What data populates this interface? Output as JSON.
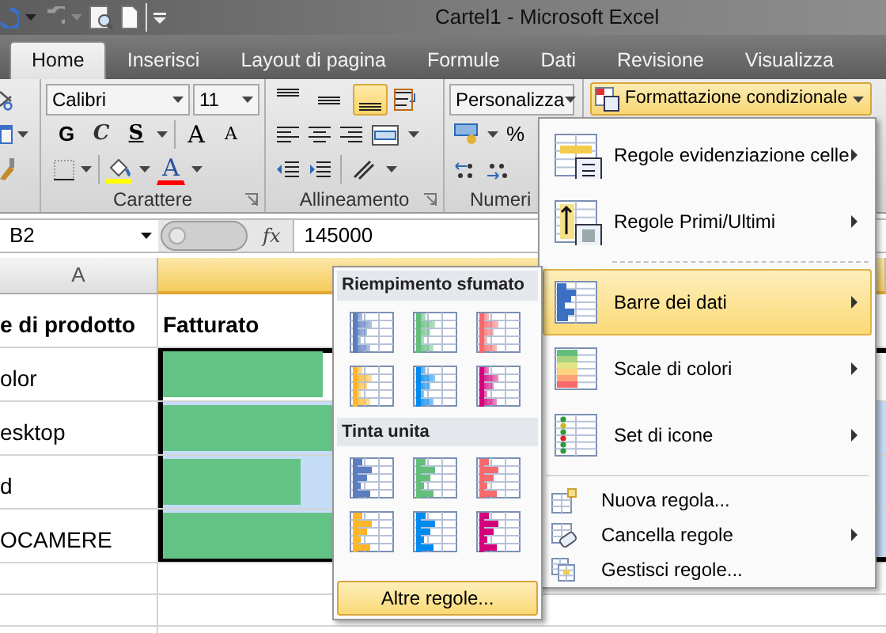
{
  "window": {
    "title": "Cartel1  -  Microsoft Excel"
  },
  "ribbon_tabs": [
    {
      "label": "Home",
      "selected": true
    },
    {
      "label": "Inserisci",
      "selected": false
    },
    {
      "label": "Layout di pagina",
      "selected": false
    },
    {
      "label": "Formule",
      "selected": false
    },
    {
      "label": "Dati",
      "selected": false
    },
    {
      "label": "Revisione",
      "selected": false
    },
    {
      "label": "Visualizza",
      "selected": false
    }
  ],
  "font_group": {
    "label": "Carattere",
    "font_name": "Calibri",
    "font_size": "11",
    "style_buttons": [
      {
        "label": "G",
        "kind": "bold"
      },
      {
        "label": "C",
        "kind": "italic"
      },
      {
        "label": "S",
        "kind": "underline"
      }
    ],
    "size_buttons": [
      {
        "label": "A",
        "kind": "grow"
      },
      {
        "label": "A",
        "kind": "shrink"
      }
    ],
    "fill_color_button": {
      "color": "#ffff00"
    },
    "font_color_button": {
      "label": "A",
      "color": "#ff0000"
    }
  },
  "alignment_group": {
    "label": "Allineamento",
    "vertical_align": [
      {
        "selected": false
      },
      {
        "selected": false
      },
      {
        "selected": true
      }
    ]
  },
  "number_group": {
    "label": "Numeri",
    "format": "Personalizza",
    "percent": "%"
  },
  "conditional_formatting": {
    "label": "Formattazione condizionale",
    "open": true
  },
  "formula_bar": {
    "name_box": "B2",
    "function_label": "fx",
    "value": "145000"
  },
  "sheet": {
    "column_headers": [
      {
        "label": "A",
        "selected": false
      },
      {
        "selected": true
      }
    ],
    "rows": [
      {
        "kind": "header",
        "cells": [
          "e di prodotto",
          "Fatturato"
        ]
      },
      {
        "kind": "data",
        "product": "olor",
        "bar": {
          "level": 0.22
        },
        "selected": true,
        "active": true
      },
      {
        "kind": "data",
        "product": "esktop",
        "bar": {
          "level": 0.5
        },
        "selected": true,
        "active": false
      },
      {
        "kind": "data",
        "product": "d",
        "bar": {
          "level": 0.19
        },
        "selected": true,
        "active": false
      },
      {
        "kind": "data",
        "product": "OCAMERE",
        "bar": {
          "level": 0.5
        },
        "selected": true,
        "active": false
      },
      {
        "kind": "empty"
      },
      {
        "kind": "empty"
      },
      {
        "kind": "empty"
      }
    ]
  },
  "menu": {
    "items": [
      {
        "kind": "large",
        "label": "Regole evidenziazione celle",
        "submenu": true,
        "selected": false
      },
      {
        "kind": "large",
        "label": "Regole Primi/Ultimi",
        "submenu": true,
        "selected": false
      },
      {
        "kind": "separator"
      },
      {
        "kind": "large",
        "label": "Barre dei dati",
        "submenu": true,
        "selected": true
      },
      {
        "kind": "large",
        "label": "Scale di colori",
        "submenu": true,
        "selected": false
      },
      {
        "kind": "large",
        "label": "Set di icone",
        "submenu": true,
        "selected": false
      },
      {
        "kind": "separator"
      },
      {
        "kind": "small",
        "label": "Nuova regola...",
        "submenu": false,
        "selected": false
      },
      {
        "kind": "small",
        "label": "Cancella regole",
        "submenu": true,
        "selected": false
      },
      {
        "kind": "small",
        "label": "Gestisci regole...",
        "submenu": false,
        "selected": false
      }
    ]
  },
  "data_bars_menu": {
    "sections": [
      {
        "title": "Riempimento sfumato",
        "kind": "gradient",
        "swatches": [
          {
            "color": "#5a7ebf"
          },
          {
            "color": "#63be7b"
          },
          {
            "color": "#f8696b"
          },
          {
            "color": "#ffb628"
          },
          {
            "color": "#008aef"
          },
          {
            "color": "#d6007b"
          }
        ]
      },
      {
        "title": "Tinta unita",
        "kind": "solid",
        "swatches": [
          {
            "color": "#5a7ebf"
          },
          {
            "color": "#63be7b"
          },
          {
            "color": "#f8696b"
          },
          {
            "color": "#ffb628"
          },
          {
            "color": "#008aef"
          },
          {
            "color": "#d6007b"
          }
        ]
      }
    ],
    "more_button": "Altre regole..."
  }
}
